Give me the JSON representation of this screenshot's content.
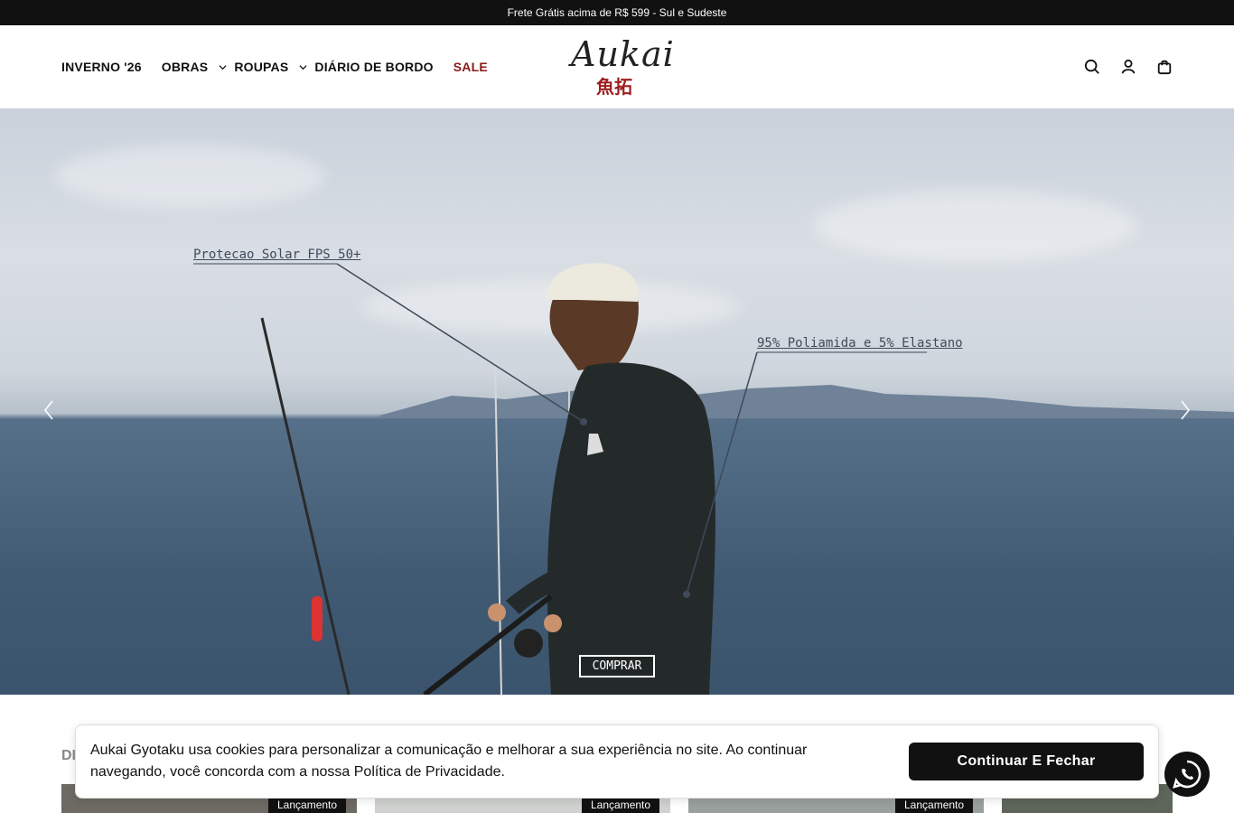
{
  "announcement": {
    "text": "Frete Grátis acima de R$ 599 - Sul e Sudeste"
  },
  "nav": {
    "items": [
      {
        "label": "INVERNO '26",
        "has_dropdown": false
      },
      {
        "label": "OBRAS",
        "has_dropdown": true
      },
      {
        "label": "ROUPAS",
        "has_dropdown": true
      },
      {
        "label": "DIÁRIO DE BORDO",
        "has_dropdown": false
      },
      {
        "label": "SALE",
        "has_dropdown": false
      }
    ]
  },
  "logo": {
    "script": "Aukai",
    "kanji": "魚拓"
  },
  "header_icons": [
    "search-icon",
    "account-icon",
    "cart-icon"
  ],
  "hero": {
    "annotation_left": "Protecao Solar FPS 50+",
    "annotation_right": "95% Poliamida e 5% Elastano",
    "cta": "COMPRAR"
  },
  "section": {
    "title_partial": "DI"
  },
  "products": [
    {
      "badge": "Lançamento"
    },
    {
      "badge": "Lançamento"
    },
    {
      "badge": "Lançamento"
    },
    {
      "badge": ""
    }
  ],
  "cookie": {
    "text": "Aukai Gyotaku usa cookies para personalizar a comunicação e melhorar a sua experiência no site. Ao continuar navegando, você concorda com a nossa Política de Privacidade.",
    "button": "Continuar E Fechar"
  },
  "colors": {
    "sale": "#8b1a1a",
    "topbar": "#111111",
    "kanji": "#9c1d1d"
  }
}
